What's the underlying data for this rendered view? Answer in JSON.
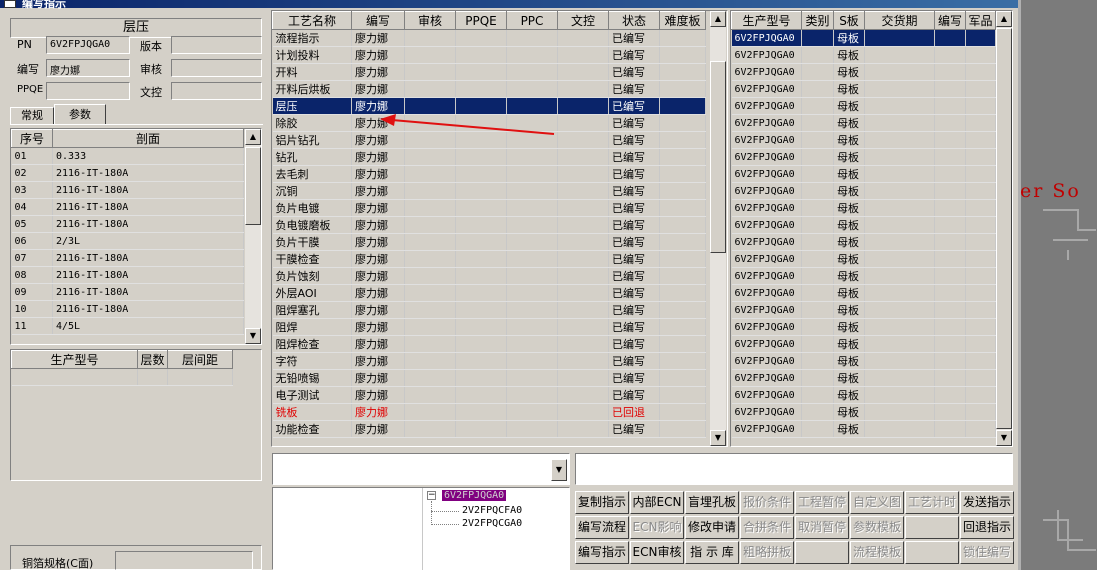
{
  "window": {
    "title": "编写指示"
  },
  "left": {
    "section_title": "层压",
    "pn_label": "PN",
    "pn_value": "6V2FPJQGA0",
    "version_label": "版本",
    "version_value": "",
    "author_label": "编写",
    "author_value": "廖力娜",
    "review_label": "审核",
    "review_value": "",
    "ppqe_label": "PPQE",
    "ppqe_value": "",
    "doc_control_label": "文控",
    "doc_control_value": "",
    "tabs": [
      "常规",
      "参数"
    ],
    "layer_table": {
      "headers": [
        "序号",
        "剖面"
      ],
      "rows": [
        [
          "01",
          "0.333"
        ],
        [
          "02",
          "2116-IT-180A"
        ],
        [
          "03",
          "2116-IT-180A"
        ],
        [
          "04",
          "2116-IT-180A"
        ],
        [
          "05",
          "2116-IT-180A"
        ],
        [
          "06",
          "2/3L"
        ],
        [
          "07",
          "2116-IT-180A"
        ],
        [
          "08",
          "2116-IT-180A"
        ],
        [
          "09",
          "2116-IT-180A"
        ],
        [
          "10",
          "2116-IT-180A"
        ],
        [
          "11",
          "4/5L"
        ]
      ]
    },
    "model_table": {
      "headers": [
        "生产型号",
        "层数",
        "层间距"
      ]
    },
    "copper_label": "铜箔规格(C面)"
  },
  "process_table": {
    "headers": [
      "工艺名称",
      "编写",
      "审核",
      "PPQE",
      "PPC",
      "文控",
      "状态",
      "难度板"
    ],
    "rows": [
      [
        "流程指示",
        "廖力娜",
        "已编写"
      ],
      [
        "计划投料",
        "廖力娜",
        "已编写"
      ],
      [
        "开料",
        "廖力娜",
        "已编写"
      ],
      [
        "开料后烘板",
        "廖力娜",
        "已编写"
      ],
      [
        "层压",
        "廖力娜",
        "已编写"
      ],
      [
        "除胶",
        "廖力娜",
        "已编写"
      ],
      [
        "铝片钻孔",
        "廖力娜",
        "已编写"
      ],
      [
        "钻孔",
        "廖力娜",
        "已编写"
      ],
      [
        "去毛刺",
        "廖力娜",
        "已编写"
      ],
      [
        "沉铜",
        "廖力娜",
        "已编写"
      ],
      [
        "负片电镀",
        "廖力娜",
        "已编写"
      ],
      [
        "负电镀磨板",
        "廖力娜",
        "已编写"
      ],
      [
        "负片干膜",
        "廖力娜",
        "已编写"
      ],
      [
        "干膜检查",
        "廖力娜",
        "已编写"
      ],
      [
        "负片蚀刻",
        "廖力娜",
        "已编写"
      ],
      [
        "外层AOI",
        "廖力娜",
        "已编写"
      ],
      [
        "阻焊塞孔",
        "廖力娜",
        "已编写"
      ],
      [
        "阻焊",
        "廖力娜",
        "已编写"
      ],
      [
        "阻焊检查",
        "廖力娜",
        "已编写"
      ],
      [
        "字符",
        "廖力娜",
        "已编写"
      ],
      [
        "无铅喷锡",
        "廖力娜",
        "已编写"
      ],
      [
        "电子测试",
        "廖力娜",
        "已编写"
      ],
      [
        "铣板",
        "廖力娜",
        "已回退"
      ],
      [
        "功能检查",
        "廖力娜",
        "已编写"
      ]
    ],
    "selected_index": 4,
    "red_index": 22
  },
  "model_table": {
    "headers": [
      "生产型号",
      "类别",
      "S板",
      "交货期",
      "编写",
      "军品"
    ],
    "model": "6V2FPJQGA0",
    "board": "母板",
    "row_count": 24
  },
  "tree": {
    "root": "6V2FPJQGA0",
    "children": [
      "2V2FPQCFA0",
      "2V2FPQCGA0"
    ]
  },
  "buttons": [
    [
      "复制指示",
      "内部ECN",
      "盲埋孔板",
      "报价条件",
      "工程暂停",
      "自定义图",
      "工艺计时",
      "发送指示"
    ],
    [
      "编写流程",
      "ECN影响",
      "修改申请",
      "合拼条件",
      "取消暂停",
      "参数模板",
      "",
      "回退指示"
    ],
    [
      "编写指示",
      "ECN审核",
      "指 示 库",
      "粗略拼板",
      "",
      "流程模板",
      "",
      "锁住编写"
    ]
  ],
  "buttons_disabled": [
    [
      false,
      false,
      false,
      true,
      true,
      true,
      true,
      false
    ],
    [
      false,
      true,
      false,
      true,
      true,
      true,
      true,
      false
    ],
    [
      false,
      false,
      false,
      true,
      true,
      true,
      true,
      true
    ]
  ],
  "desktop_text": "er So"
}
